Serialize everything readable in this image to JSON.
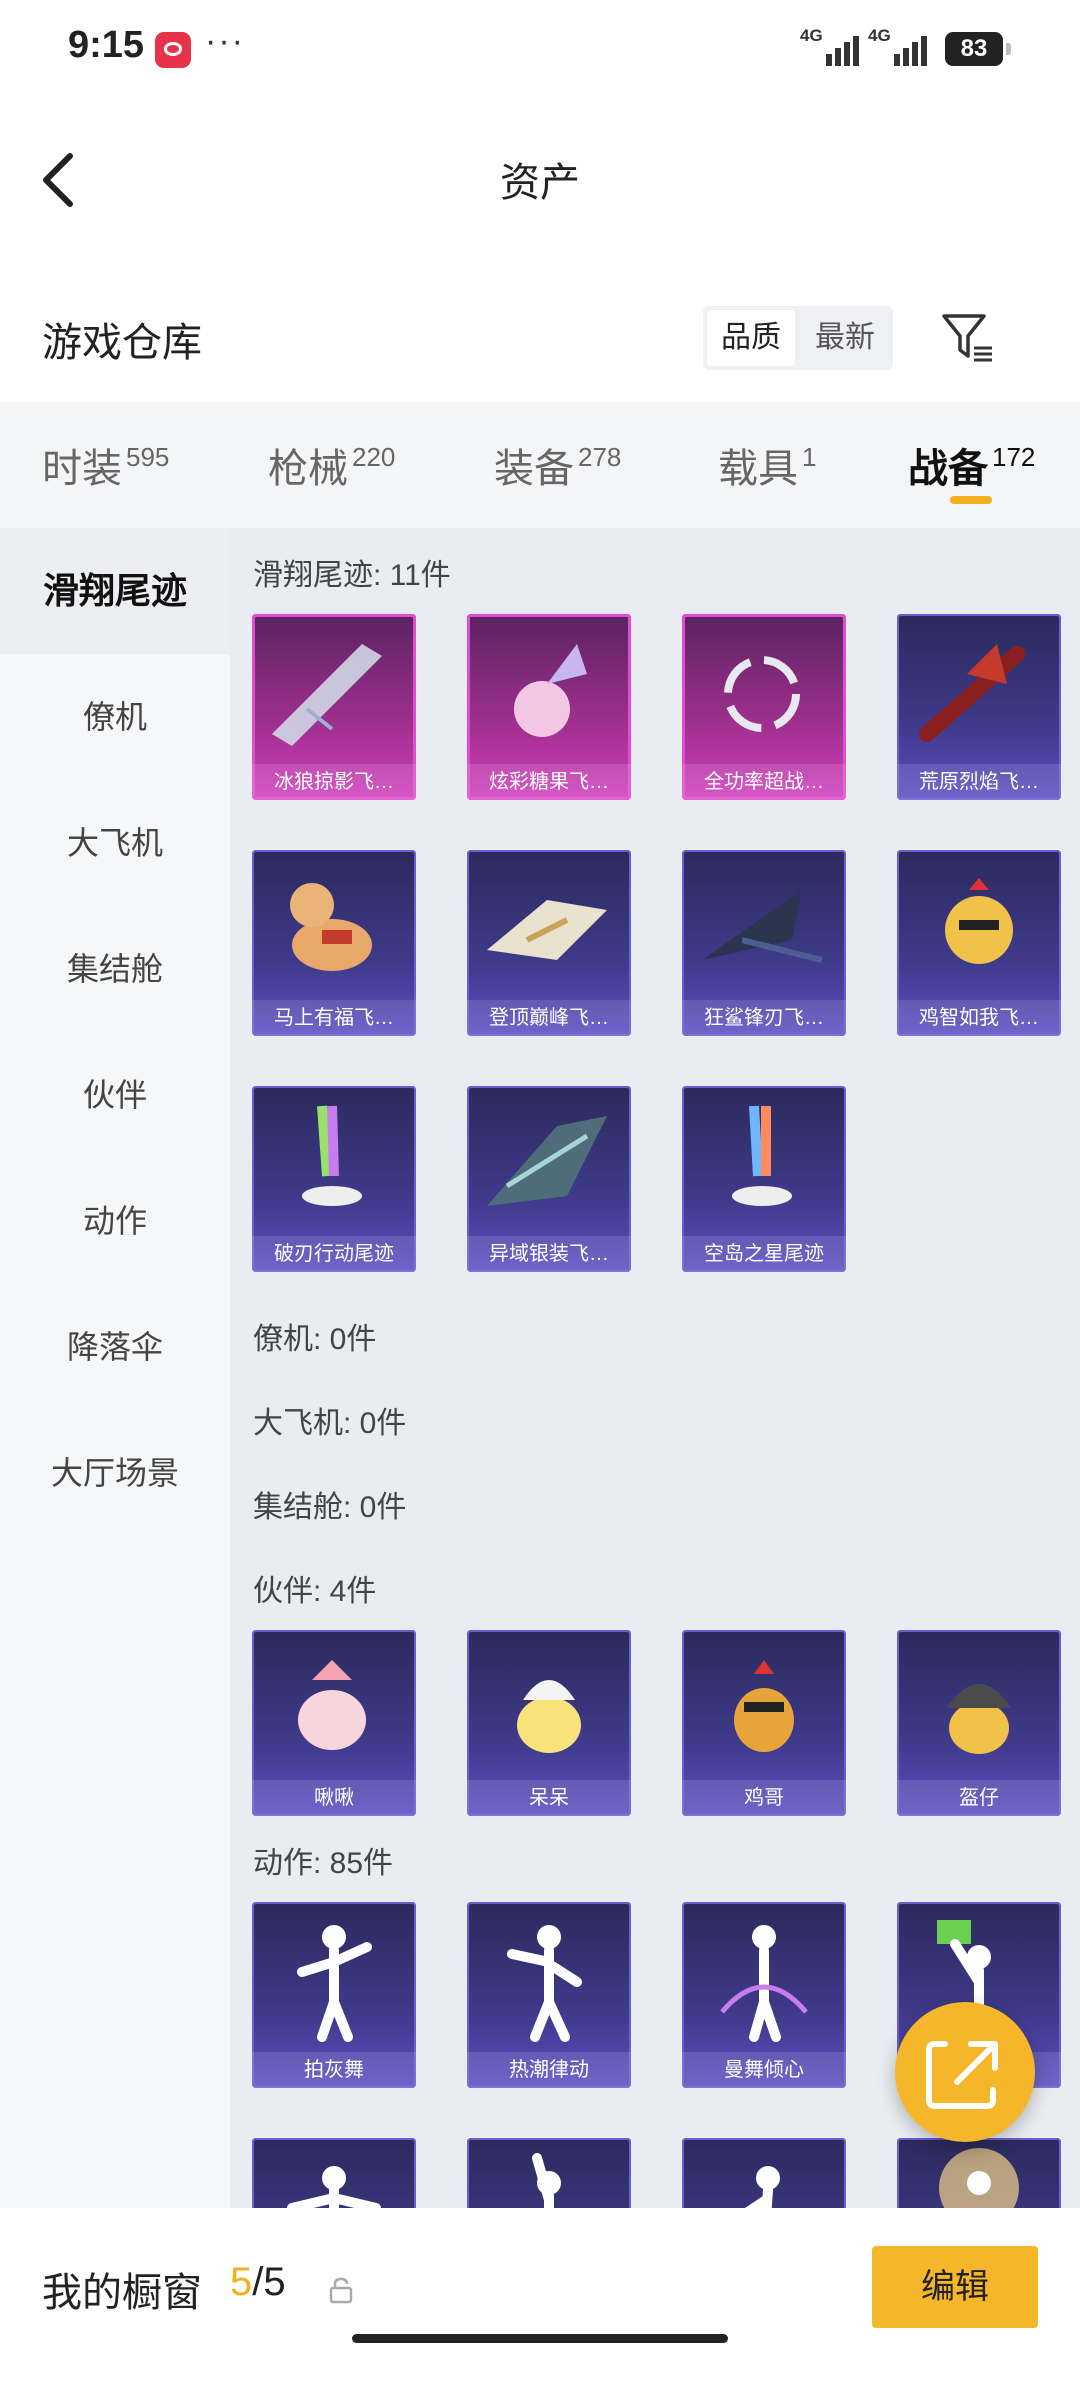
{
  "status_bar": {
    "time": "9:15",
    "more": "···",
    "network1": "4G",
    "network2": "4G",
    "battery": "83"
  },
  "header": {
    "title": "资产"
  },
  "warehouse": {
    "title": "游戏仓库",
    "sort_options": [
      "品质",
      "最新"
    ]
  },
  "category_tabs": [
    {
      "label": "时装",
      "count": "595"
    },
    {
      "label": "枪械",
      "count": "220"
    },
    {
      "label": "装备",
      "count": "278"
    },
    {
      "label": "载具",
      "count": "1"
    },
    {
      "label": "战备",
      "count": "172"
    }
  ],
  "sidebar": [
    "滑翔尾迹",
    "僚机",
    "大飞机",
    "集结舱",
    "伙伴",
    "动作",
    "降落伞",
    "大厅场景"
  ],
  "sections": {
    "glide_trail": {
      "title": "滑翔尾迹: 11件",
      "items": [
        "冰狼掠影飞…",
        "炫彩糖果飞…",
        "全功率超战…",
        "荒原烈焰飞…",
        "马上有福飞…",
        "登顶巅峰飞…",
        "狂鲨锋刃飞…",
        "鸡智如我飞…",
        "破刃行动尾迹",
        "异域银装飞…",
        "空岛之星尾迹"
      ]
    },
    "wingman": {
      "title": "僚机: 0件"
    },
    "big_plane": {
      "title": "大飞机: 0件"
    },
    "rally_pod": {
      "title": "集结舱: 0件"
    },
    "partner": {
      "title": "伙伴: 4件",
      "items": [
        "啾啾",
        "呆呆",
        "鸡哥",
        "盔仔"
      ]
    },
    "emote": {
      "title": "动作: 85件",
      "items": [
        "拍灰舞",
        "热潮律动",
        "曼舞倾心",
        "",
        "",
        "",
        "",
        ""
      ]
    }
  },
  "bottom": {
    "window_label": "我的橱窗",
    "window_used": "5",
    "window_sep_total": "/5",
    "edit_label": "编辑"
  },
  "colors": {
    "accent": "#f5b62a",
    "card_purple": "#3f3a8a",
    "card_pink": "#d23fbf"
  }
}
